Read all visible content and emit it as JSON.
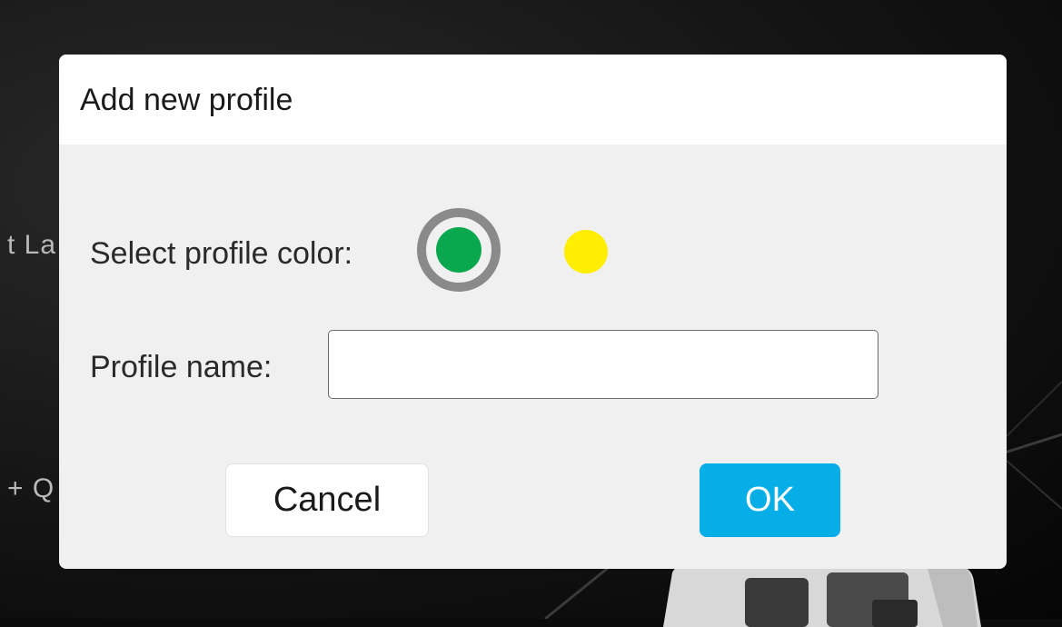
{
  "background": {
    "partial_text_1": "t La",
    "partial_text_2": "+ Q"
  },
  "dialog": {
    "title": "Add new profile",
    "color_label": "Select profile color:",
    "name_label": "Profile name:",
    "name_value": "",
    "name_placeholder": "",
    "colors": [
      {
        "name": "green",
        "hex": "#0aa84e",
        "selected": true
      },
      {
        "name": "yellow",
        "hex": "#ffee00",
        "selected": false
      }
    ],
    "selection_ring_color": "#8a8a8a",
    "cancel_label": "Cancel",
    "ok_label": "OK",
    "ok_color": "#06aee8"
  }
}
